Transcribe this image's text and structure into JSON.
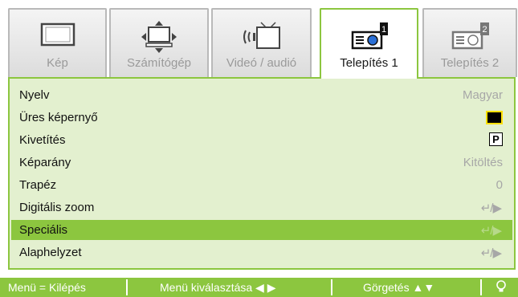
{
  "tabs": [
    {
      "label": "Kép",
      "icon": "screen-icon",
      "active": false
    },
    {
      "label": "Számítógép",
      "icon": "computer-icon",
      "active": false
    },
    {
      "label": "Videó / audió",
      "icon": "video-audio-icon",
      "active": false
    },
    {
      "label": "Telepítés 1",
      "icon": "projector-setup1-icon",
      "active": true
    },
    {
      "label": "Telepítés 2",
      "icon": "projector-setup2-icon",
      "active": false
    }
  ],
  "menu": [
    {
      "label": "Nyelv",
      "value": "Magyar"
    },
    {
      "label": "Üres képernyő",
      "value_icon": "black-screen-icon"
    },
    {
      "label": "Kivetítés",
      "value": "P"
    },
    {
      "label": "Képarány",
      "value": "Kitöltés"
    },
    {
      "label": "Trapéz",
      "value": "0"
    },
    {
      "label": "Digitális zoom",
      "value": "↵/▶"
    },
    {
      "label": "Speciális",
      "value": "↵/▶",
      "selected": true
    },
    {
      "label": "Alaphelyzet",
      "value": "↵/▶"
    }
  ],
  "footer": {
    "exit": "Menü = Kilépés",
    "select": "Menü kiválasztása ◀ ▶",
    "scroll": "Görgetés ▲▼",
    "info_icon": "bulb-icon"
  },
  "colors": {
    "accent": "#8cc63f",
    "panel": "#e3f0cf",
    "highlight": "#ffe000"
  }
}
